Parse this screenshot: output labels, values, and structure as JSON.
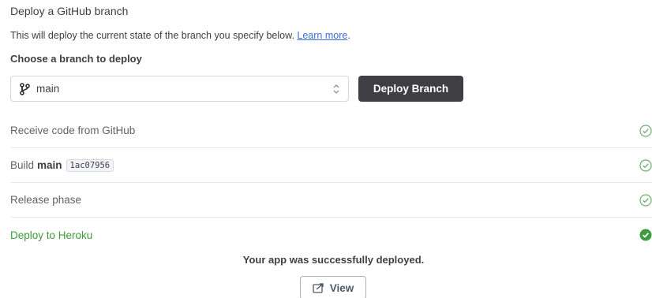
{
  "header": {
    "title": "Deploy a GitHub branch",
    "description": "This will deploy the current state of the branch you specify below.",
    "learn_more": "Learn more",
    "description_suffix": ".",
    "choose_label": "Choose a branch to deploy"
  },
  "branch_select": {
    "value": "main"
  },
  "deploy_button": {
    "label": "Deploy Branch"
  },
  "steps": [
    {
      "label": "Receive code from GitHub",
      "status": "done"
    },
    {
      "label_prefix": "Build",
      "label_bold": "main",
      "commit": "1ac07956",
      "status": "done"
    },
    {
      "label": "Release phase",
      "status": "done"
    },
    {
      "label": "Deploy to Heroku",
      "status": "success"
    }
  ],
  "result": {
    "message": "Your app was successfully deployed.",
    "view_label": "View"
  },
  "colors": {
    "success_green": "#3e9b3e",
    "button_dark": "#3e3e43",
    "link_blue": "#3b6fd6"
  }
}
